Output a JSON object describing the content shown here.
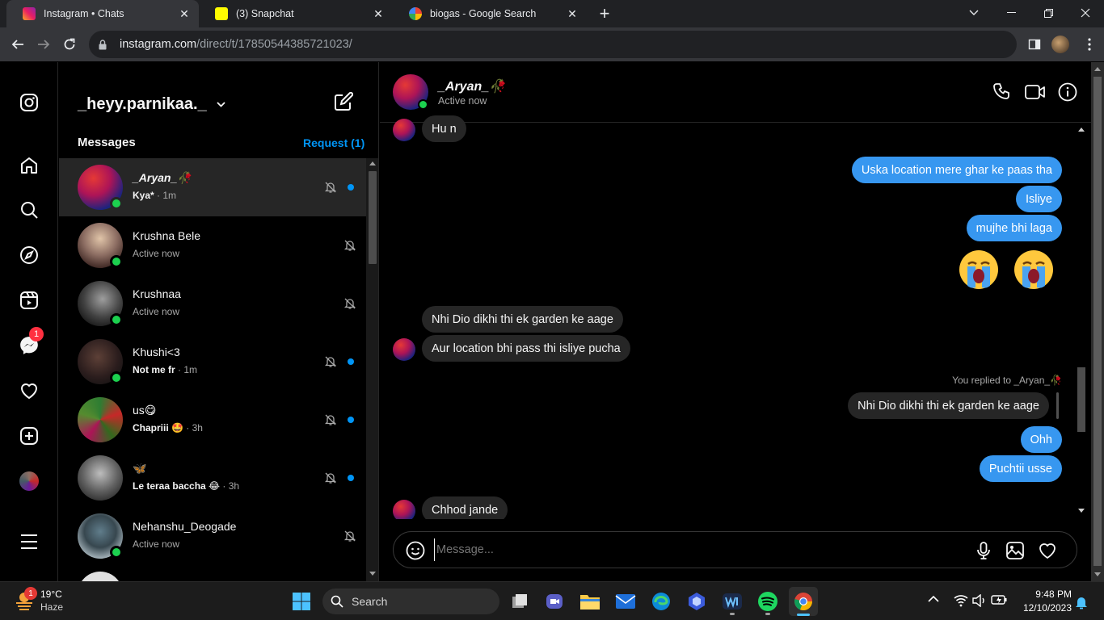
{
  "browser": {
    "tabs": [
      {
        "title": "Instagram • Chats",
        "active": true
      },
      {
        "title": "(3) Snapchat",
        "active": false
      },
      {
        "title": "biogas - Google Search",
        "active": false
      }
    ],
    "url_host": "instagram.com",
    "url_path": "/direct/t/17850544385721023/"
  },
  "sidebar": {
    "username": "_heyy.parnikaa._",
    "messages_label": "Messages",
    "request_label": "Request (1)",
    "notification_badge": "1"
  },
  "threads": [
    {
      "name": "_Aryan_🥀",
      "sub": "Kya*",
      "time": "· 1m",
      "unread": true,
      "online": true,
      "muted": true,
      "active": true
    },
    {
      "name": "Krushna Bele",
      "sub": "Active now",
      "time": "",
      "unread": false,
      "online": true,
      "muted": true,
      "active": false
    },
    {
      "name": "Krushnaa",
      "sub": "Active now",
      "time": "",
      "unread": false,
      "online": true,
      "muted": true,
      "active": false
    },
    {
      "name": "Khushi<3",
      "sub": "Not me fr",
      "time": "· 1m",
      "unread": true,
      "online": true,
      "muted": true,
      "active": false
    },
    {
      "name": "us😋",
      "sub": "Chapriii 🤩",
      "time": "· 3h",
      "unread": true,
      "online": false,
      "muted": true,
      "active": false
    },
    {
      "name": "🦋",
      "sub": "Le teraa baccha 😂",
      "time": "· 3h",
      "unread": true,
      "online": false,
      "muted": true,
      "active": false
    },
    {
      "name": "Nehanshu_Deogade",
      "sub": "Active now",
      "time": "",
      "unread": false,
      "online": true,
      "muted": true,
      "active": false
    }
  ],
  "chat": {
    "name": "_Aryan_🥀",
    "status": "Active now",
    "messages": {
      "m1": "Hu n",
      "m2": "Uska location mere ghar ke paas tha",
      "m3": "Isliye",
      "m4": "mujhe bhi laga",
      "m5": "Nhi Dio dikhi thi ek garden ke aage",
      "m6": "Aur location bhi pass thi isliye pucha",
      "reply_label": "You replied to _Aryan_🥀",
      "reply_quote": "Nhi Dio dikhi thi ek garden ke aage",
      "m7": "Ohh",
      "m8": "Puchtii usse",
      "m9": "Chhod jande"
    },
    "composer_placeholder": "Message..."
  },
  "taskbar": {
    "weather_temp": "19°C",
    "weather_desc": "Haze",
    "weather_badge": "1",
    "search_label": "Search",
    "time": "9:48 PM",
    "date": "12/10/2023"
  },
  "colors": {
    "accent_blue": "#0095f6",
    "outgoing_bubble": "#3797f0",
    "incoming_bubble": "#262626",
    "online_green": "#1cd14f"
  }
}
